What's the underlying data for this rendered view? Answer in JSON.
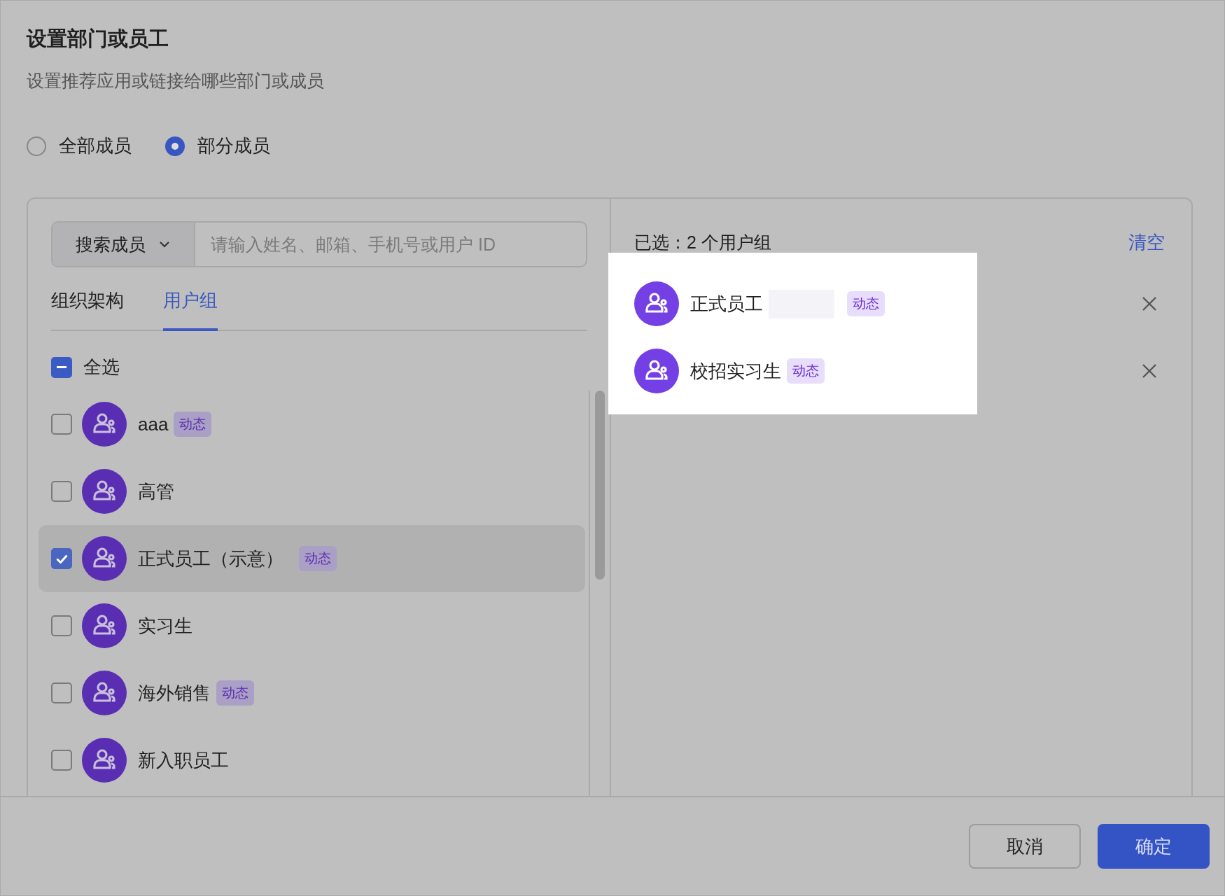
{
  "dialog": {
    "title": "设置部门或员工",
    "subtitle": "设置推荐应用或链接给哪些部门或成员"
  },
  "scope_options": [
    {
      "label": "全部成员",
      "selected": false
    },
    {
      "label": "部分成员",
      "selected": true
    }
  ],
  "search": {
    "dropdown_label": "搜索成员",
    "placeholder": "请输入姓名、邮箱、手机号或用户 ID"
  },
  "tabs": [
    {
      "label": "组织架构",
      "selected": false
    },
    {
      "label": "用户组",
      "selected": true
    }
  ],
  "select_all": {
    "label": "全选",
    "indeterminate": true
  },
  "groups": [
    {
      "name": "aaa",
      "tag": "动态",
      "checked": false,
      "hovered": false
    },
    {
      "name": "高管",
      "checked": false,
      "hovered": false
    },
    {
      "name": "正式员工（示意）",
      "tag": "动态",
      "checked": true,
      "hovered": true
    },
    {
      "name": "实习生",
      "checked": false,
      "hovered": false
    },
    {
      "name": "海外销售",
      "tag": "动态",
      "checked": false,
      "hovered": false
    },
    {
      "name": "新入职员工",
      "checked": false,
      "hovered": false
    }
  ],
  "selected_panel": {
    "summary": "已选：2 个用户组",
    "clear_link": "清空",
    "spotlight": true,
    "items": [
      {
        "name": "正式员工",
        "tag": "动态",
        "redacted": true
      },
      {
        "name": "校招实习生",
        "tag": "动态",
        "redacted": false
      }
    ]
  },
  "buttons": [
    {
      "label": "取消",
      "kind": "secondary"
    },
    {
      "label": "确定",
      "kind": "primary"
    }
  ]
}
